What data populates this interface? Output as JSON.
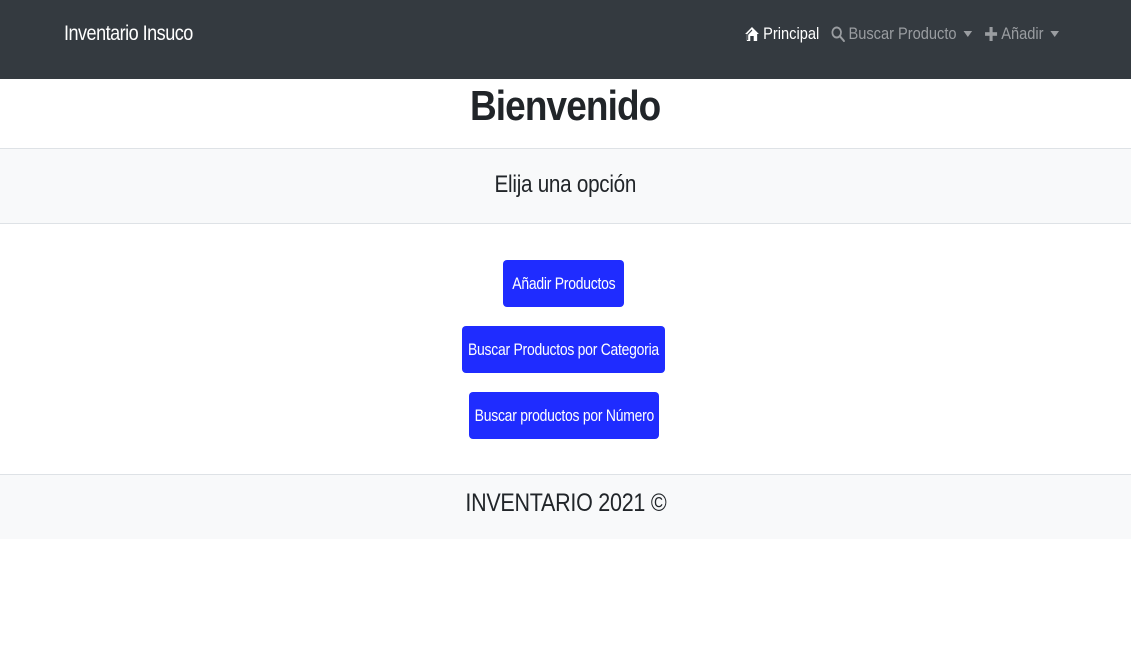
{
  "navbar": {
    "brand": "Inventario Insuco",
    "items": [
      {
        "label": "Principal",
        "icon": "home-icon",
        "active": true
      },
      {
        "label": "Buscar Producto",
        "icon": "search-icon",
        "dropdown": true
      },
      {
        "label": "Añadir",
        "icon": "plus-icon",
        "dropdown": true
      }
    ]
  },
  "main": {
    "title": "Bienvenido",
    "subtitle": "Elija una opción",
    "buttons": [
      {
        "label": "Añadir Productos"
      },
      {
        "label": "Buscar Productos por Categoria"
      },
      {
        "label": "Buscar productos por Número"
      }
    ]
  },
  "footer": {
    "text": "INVENTARIO 2021 ©"
  },
  "colors": {
    "navbar_bg": "#343a40",
    "button_bg": "#1f2cff",
    "band_bg": "#f8f9fa",
    "text": "#212529"
  }
}
